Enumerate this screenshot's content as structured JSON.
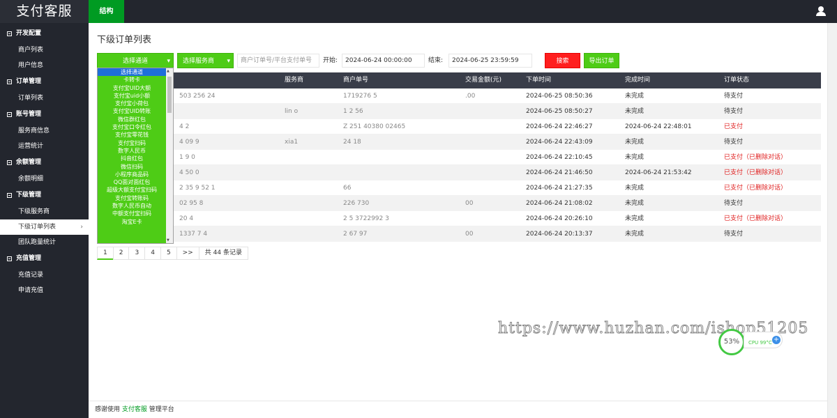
{
  "app": {
    "brand": "支付客服",
    "top_tab": "结构"
  },
  "sidebar": {
    "groups": [
      {
        "title": "开发配置",
        "items": [
          "商户列表",
          "用户信息"
        ]
      },
      {
        "title": "订单管理",
        "items": [
          "订单列表"
        ]
      },
      {
        "title": "账号管理",
        "items": [
          "服务商信息",
          "运营统计"
        ]
      },
      {
        "title": "余额管理",
        "items": [
          "余额明细"
        ]
      },
      {
        "title": "下级管理",
        "items": [
          "下级服务商",
          "下级订单列表",
          "团队跑量统计"
        ]
      },
      {
        "title": "充值管理",
        "items": [
          "充值记录",
          "申请充值"
        ]
      }
    ],
    "active_item": "下级订单列表",
    "active_arrow": "›"
  },
  "page": {
    "title": "下级订单列表"
  },
  "filters": {
    "channel_select": "选择通道",
    "provider_select": "选择服务商",
    "order_placeholder": "商户订单号/平台支付单号",
    "start_label": "开始:",
    "start_value": "2024-06-24 00:00:00",
    "end_label": "结束:",
    "end_value": "2024-06-25 23:59:59",
    "search_button": "搜索",
    "export_button": "导出订单",
    "caret": "▾"
  },
  "dropdown": {
    "options": [
      "选择通道",
      "卡转卡",
      "支付宝UID大额",
      "支付宝uid小额",
      "支付宝小荷包",
      "支付宝UID转账",
      "微信群红包",
      "支付宝口令红包",
      "支付宝零花钱",
      "支付宝扫码",
      "数字人民币",
      "抖音红包",
      "微信扫码",
      "小程序商品码",
      "QQ面对面红包",
      "超级大额支付宝扫码",
      "支付宝转账码",
      "数字人民币自动",
      "中额支付宝扫码",
      "淘宝E卡"
    ],
    "selected": "选择通道"
  },
  "table": {
    "headers": [
      "服务商",
      "商户单号",
      "交易金额(元)",
      "下单时间",
      "完成时间",
      "订单状态"
    ],
    "rows": [
      {
        "col1": "503 256 24",
        "provider": "",
        "merchant_no": "1719276 5",
        "amount": ".00",
        "order_time": "2024-06-25 08:50:36",
        "done_time": "未完成",
        "status": "待支付",
        "status_red": false
      },
      {
        "col1": "",
        "provider": "lin o",
        "merchant_no": "1 2 56",
        "amount": "",
        "order_time": "2024-06-25 08:50:27",
        "done_time": "未完成",
        "status": "待支付",
        "status_red": false
      },
      {
        "col1": "4 2",
        "provider": "",
        "merchant_no": "Z 251 40380 02465",
        "amount": "",
        "order_time": "2024-06-24 22:46:27",
        "done_time": "2024-06-24 22:48:01",
        "status": "已支付",
        "status_red": true
      },
      {
        "col1": "4 09 9",
        "provider": "xia1",
        "merchant_no": "24 18",
        "amount": "",
        "order_time": "2024-06-24 22:43:09",
        "done_time": "未完成",
        "status": "待支付",
        "status_red": false
      },
      {
        "col1": "1 9 0",
        "provider": "",
        "merchant_no": "",
        "amount": "",
        "order_time": "2024-06-24 22:10:45",
        "done_time": "未完成",
        "status": "已支付（已删除对话）",
        "status_red": true
      },
      {
        "col1": "4 50 0",
        "provider": "",
        "merchant_no": "",
        "amount": "",
        "order_time": "2024-06-24 21:46:50",
        "done_time": "2024-06-24 21:53:42",
        "status": "已支付（已删除对话）",
        "status_red": true
      },
      {
        "col1": "2 35 9 52 1",
        "provider": "",
        "merchant_no": "66",
        "amount": "",
        "order_time": "2024-06-24 21:27:35",
        "done_time": "未完成",
        "status": "已支付（已删除对话）",
        "status_red": true
      },
      {
        "col1": "02 95 8",
        "provider": "",
        "merchant_no": "226 730",
        "amount": "00",
        "order_time": "2024-06-24 21:08:02",
        "done_time": "未完成",
        "status": "待支付",
        "status_red": false
      },
      {
        "col1": "20 4",
        "provider": "",
        "merchant_no": "2 5 3722992 3",
        "amount": "",
        "order_time": "2024-06-24 20:26:10",
        "done_time": "未完成",
        "status": "已支付（已删除对话）",
        "status_red": true
      },
      {
        "col1": "1337 7 4",
        "provider": "",
        "merchant_no": "2 67 97",
        "amount": "00",
        "order_time": "2024-06-24 20:13:37",
        "done_time": "未完成",
        "status": "待支付",
        "status_red": false
      }
    ]
  },
  "pagination": {
    "pages": [
      "1",
      "2",
      "3",
      "4",
      "5"
    ],
    "next": ">>",
    "total": "共 44 条记录"
  },
  "watermark": "https://www.huzhan.com/ishop51205",
  "cpu_widget": {
    "percent": "53%",
    "label": "CPU 99°C",
    "plus": "+"
  },
  "footer": {
    "prefix": "感谢使用",
    "product": "支付客服",
    "suffix": "管理平台"
  },
  "colors": {
    "accent": "#4ecc16",
    "header": "#23262e",
    "danger": "#e02020",
    "table_head": "#393d49"
  }
}
